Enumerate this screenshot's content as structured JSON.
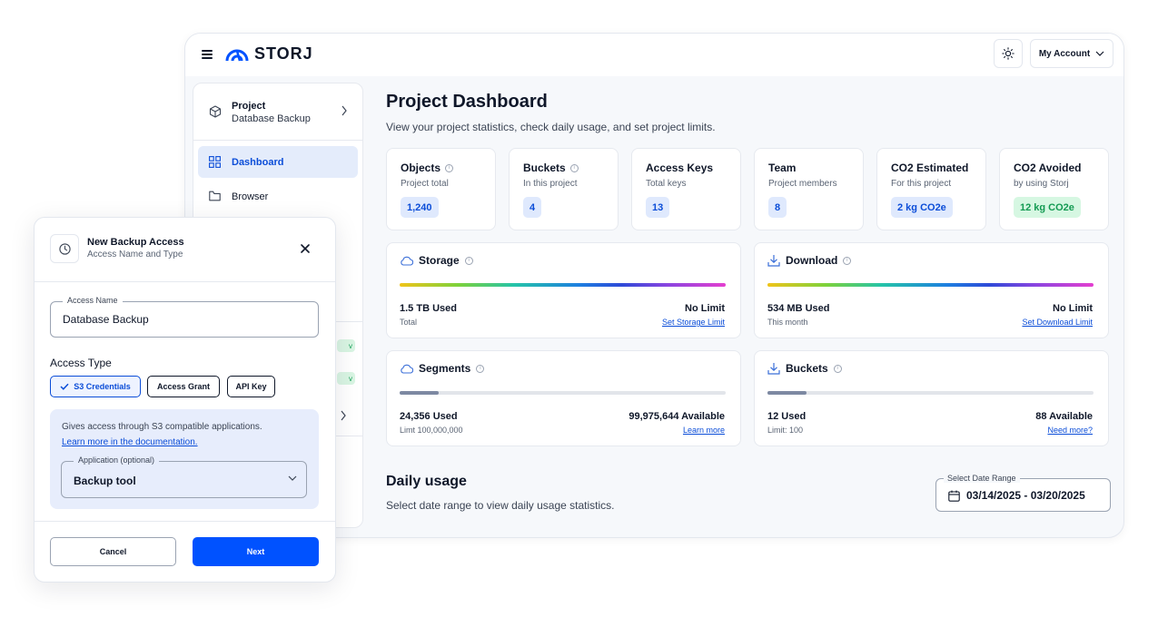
{
  "app": {
    "logo_text": "STORJ",
    "account_label": "My Account"
  },
  "sidebar": {
    "project_label": "Project",
    "project_name": "Database Backup",
    "items": [
      {
        "label": "Dashboard",
        "active": true,
        "icon": "grid-icon"
      },
      {
        "label": "Browser",
        "active": false,
        "icon": "folder-icon"
      }
    ]
  },
  "dashboard": {
    "title": "Project Dashboard",
    "subtitle": "View your project statistics, check daily usage, and set project limits.",
    "stats": [
      {
        "title": "Objects",
        "sub": "Project total",
        "value": "1,240",
        "info": true
      },
      {
        "title": "Buckets",
        "sub": "In this project",
        "value": "4",
        "info": true
      },
      {
        "title": "Access Keys",
        "sub": "Total keys",
        "value": "13",
        "info": false
      },
      {
        "title": "Team",
        "sub": "Project members",
        "value": "8",
        "info": false
      },
      {
        "title": "CO2 Estimated",
        "sub": "For this project",
        "value": "2 kg CO2e",
        "info": false
      },
      {
        "title": "CO2 Avoided",
        "sub": "by using Storj",
        "value": "12 kg CO2e",
        "info": false
      }
    ],
    "cards": [
      {
        "title": "Storage",
        "icon": "cloud-icon",
        "used": "1.5 TB Used",
        "used_sub": "Total",
        "limit": "No Limit",
        "action": "Set Storage Limit",
        "fill": 1.0
      },
      {
        "title": "Download",
        "icon": "download-icon",
        "used": "534 MB Used",
        "used_sub": "This month",
        "limit": "No Limit",
        "action": "Set Download Limit",
        "fill": 1.0
      },
      {
        "title": "Segments",
        "icon": "cloud-icon",
        "used": "24,356 Used",
        "used_sub": "Limt 100,000,000",
        "limit": "99,975,644 Available",
        "action": "Learn more",
        "fill": 0.12
      },
      {
        "title": "Buckets",
        "icon": "download-icon",
        "used": "12 Used",
        "used_sub": "Limit: 100",
        "limit": "88 Available",
        "action": "Need more?",
        "fill": 0.12
      }
    ],
    "daily_title": "Daily usage",
    "daily_sub": "Select date range to view daily usage statistics.",
    "date_label": "Select Date Range",
    "date_value": "03/14/2025 - 03/20/2025"
  },
  "modal": {
    "title": "New Backup Access",
    "subtitle": "Access Name and Type",
    "name_label": "Access Name",
    "name_value": "Database Backup",
    "type_label": "Access Type",
    "types": [
      "S3 Credentials",
      "Access Grant",
      "API Key"
    ],
    "selected_type": "S3 Credentials",
    "info_text": "Gives access through S3 compatible applications.",
    "info_link": "Learn more in the documentation.",
    "app_label": "Application (optional)",
    "app_value": "Backup tool",
    "cancel": "Cancel",
    "next": "Next"
  },
  "colors": {
    "accent": "#0052ff",
    "accent_text": "#0b4dd8",
    "badge_blue": "#dfe9fd",
    "badge_green": "#d6f7e2"
  }
}
